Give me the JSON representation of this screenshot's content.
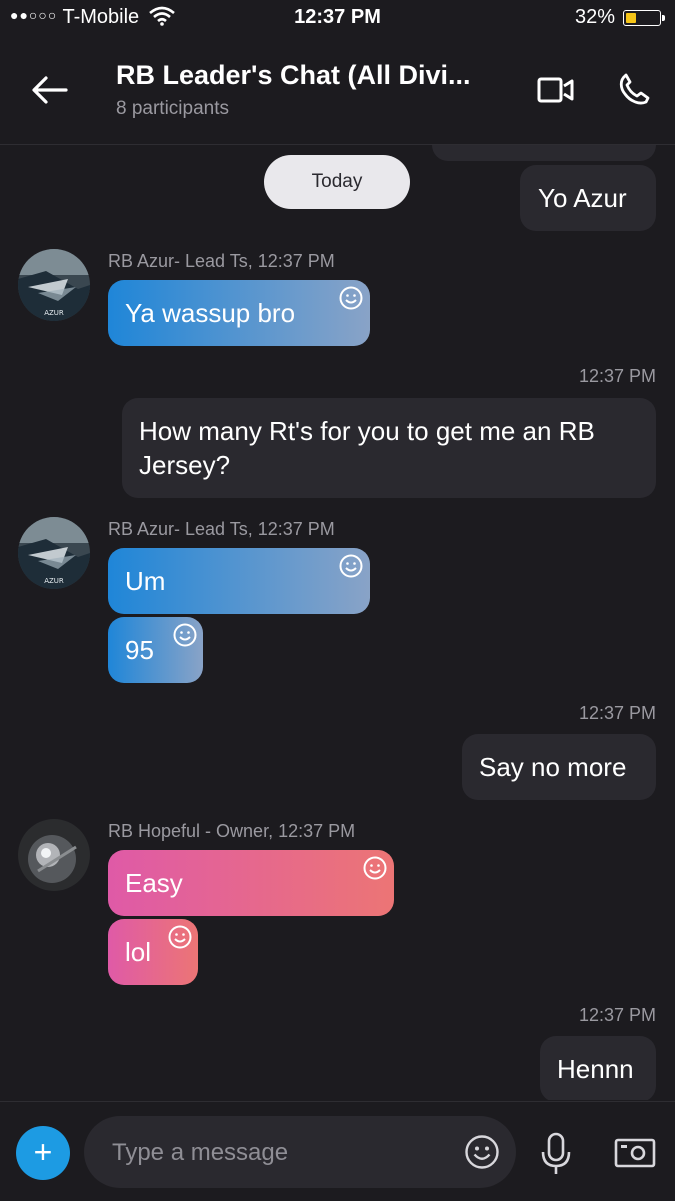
{
  "status_bar": {
    "signal": "●●○○○",
    "carrier": "T-Mobile",
    "time": "12:37 PM",
    "battery_percent": "32%",
    "battery_level": 0.32,
    "battery_color": "#f5c518"
  },
  "header": {
    "title": "RB Leader's Chat (All Divi...",
    "subtitle": "8 participants",
    "icons": [
      "back-arrow-icon",
      "video-call-icon",
      "phone-call-icon"
    ]
  },
  "date_pill": "Today",
  "messages": [
    {
      "direction": "out",
      "text": "Yo Azur"
    },
    {
      "direction": "in",
      "sender": "RB Azur- Lead Ts, 12:37 PM",
      "texts": [
        "Ya wassup bro"
      ]
    },
    {
      "direction": "out",
      "time": "12:37 PM",
      "text": "How many Rt's for you to get me an RB Jersey?"
    },
    {
      "direction": "in",
      "sender": "RB Azur- Lead Ts, 12:37 PM",
      "texts": [
        "Um",
        "95"
      ]
    },
    {
      "direction": "out",
      "time": "12:37 PM",
      "text": "Say no more"
    },
    {
      "direction": "in",
      "sender": "RB Hopeful - Owner, 12:37 PM",
      "texts": [
        "Easy",
        "lol"
      ]
    },
    {
      "direction": "out",
      "time": "12:37 PM",
      "text": "Hennn"
    }
  ],
  "avatars": {
    "azur_label": "AZUR"
  },
  "composer": {
    "placeholder": "Type a message",
    "value": "",
    "icons": [
      "add-icon",
      "emoji-icon",
      "microphone-icon",
      "camera-icon"
    ]
  },
  "colors": {
    "background": "#1c1b1f",
    "outgoing_bubble": "#2a292f",
    "azur_bubble_start": "#1f86d8",
    "azur_bubble_end": "#89a3c7",
    "hopeful_bubble_start": "#df5aa7",
    "hopeful_bubble_end": "#ec7575",
    "accent": "#1d9be3"
  }
}
